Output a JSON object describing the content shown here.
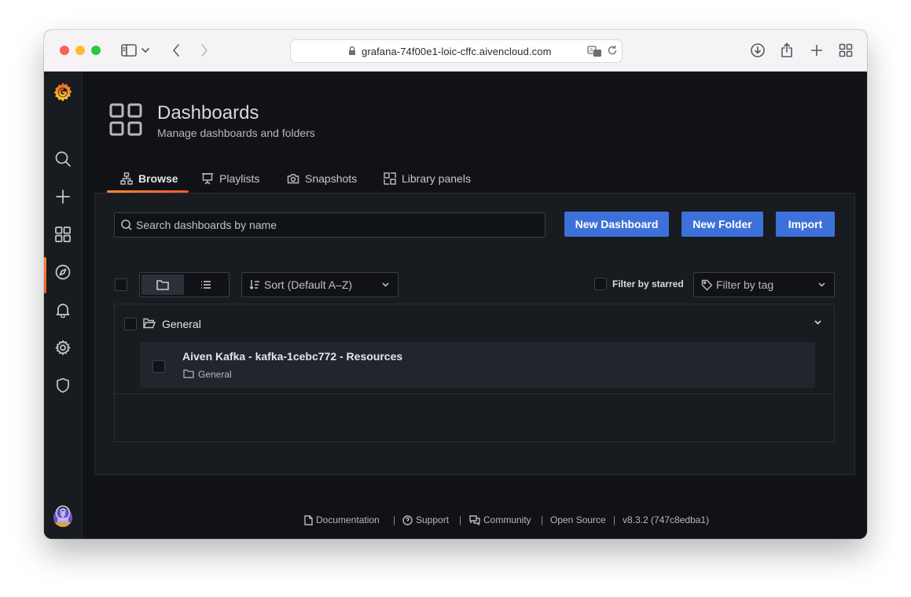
{
  "browser": {
    "url": "grafana-74f00e1-loic-cffc.aivencloud.com"
  },
  "header": {
    "title": "Dashboards",
    "subtitle": "Manage dashboards and folders"
  },
  "tabs": [
    {
      "label": "Browse",
      "icon": "sitemap-icon",
      "active": true
    },
    {
      "label": "Playlists",
      "icon": "presentation-icon",
      "active": false
    },
    {
      "label": "Snapshots",
      "icon": "camera-icon",
      "active": false
    },
    {
      "label": "Library panels",
      "icon": "library-panels-icon",
      "active": false
    }
  ],
  "toolbar": {
    "search_placeholder": "Search dashboards by name",
    "new_dashboard_label": "New Dashboard",
    "new_folder_label": "New Folder",
    "import_label": "Import",
    "sort_label": "Sort (Default A–Z)",
    "filter_starred_label": "Filter by starred",
    "filter_tag_placeholder": "Filter by tag"
  },
  "results": {
    "folders": [
      {
        "name": "General",
        "dashboards": [
          {
            "title": "Aiven Kafka - kafka-1cebc772 - Resources",
            "location": "General"
          }
        ]
      }
    ]
  },
  "footer": {
    "documentation": "Documentation",
    "support": "Support",
    "community": "Community",
    "open_source": "Open Source",
    "version": "v8.3.2 (747c8edba1)",
    "separator": "|"
  },
  "colors": {
    "accent_orange": "#f05a28",
    "primary_button": "#3d71d9",
    "background": "#111217",
    "panel": "#181b1f"
  }
}
